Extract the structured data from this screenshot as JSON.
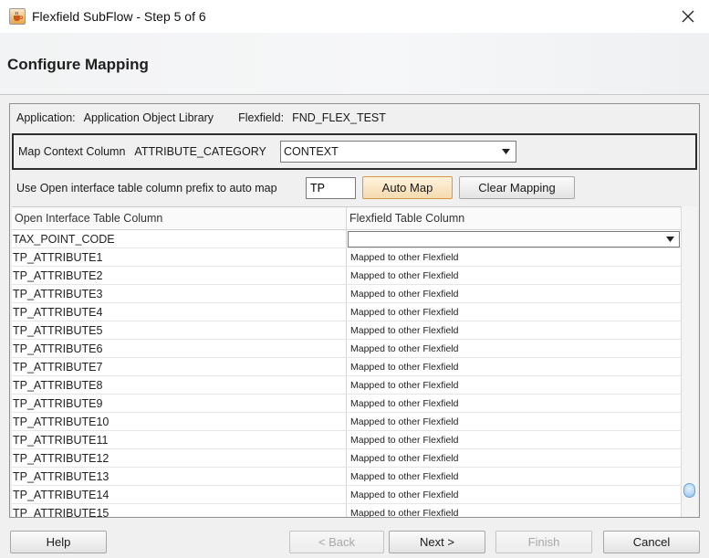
{
  "window": {
    "title": "Flexfield SubFlow - Step 5 of 6",
    "app_icon": "java-cup-icon",
    "close_icon": "close-x-icon"
  },
  "header": {
    "title": "Configure Mapping"
  },
  "info": {
    "application_label": "Application:",
    "application_value": "Application Object Library",
    "flexfield_label": "Flexfield:",
    "flexfield_value": "FND_FLEX_TEST"
  },
  "context": {
    "label": "Map Context Column",
    "column": "ATTRIBUTE_CATEGORY",
    "selected": "CONTEXT"
  },
  "prefix": {
    "label": "Use Open interface table column prefix to auto map",
    "value": "TP",
    "auto_map_label": "Auto Map",
    "clear_mapping_label": "Clear Mapping"
  },
  "grid": {
    "columns": [
      "Open Interface Table Column",
      "Flexfield Table Column"
    ],
    "rows": [
      {
        "column": "TAX_POINT_CODE",
        "mapping": ""
      },
      {
        "column": "TP_ATTRIBUTE1",
        "mapping": "Mapped to other Flexfield"
      },
      {
        "column": "TP_ATTRIBUTE2",
        "mapping": "Mapped to other Flexfield"
      },
      {
        "column": "TP_ATTRIBUTE3",
        "mapping": "Mapped to other Flexfield"
      },
      {
        "column": "TP_ATTRIBUTE4",
        "mapping": "Mapped to other Flexfield"
      },
      {
        "column": "TP_ATTRIBUTE5",
        "mapping": "Mapped to other Flexfield"
      },
      {
        "column": "TP_ATTRIBUTE6",
        "mapping": "Mapped to other Flexfield"
      },
      {
        "column": "TP_ATTRIBUTE7",
        "mapping": "Mapped to other Flexfield"
      },
      {
        "column": "TP_ATTRIBUTE8",
        "mapping": "Mapped to other Flexfield"
      },
      {
        "column": "TP_ATTRIBUTE9",
        "mapping": "Mapped to other Flexfield"
      },
      {
        "column": "TP_ATTRIBUTE10",
        "mapping": "Mapped to other Flexfield"
      },
      {
        "column": "TP_ATTRIBUTE11",
        "mapping": "Mapped to other Flexfield"
      },
      {
        "column": "TP_ATTRIBUTE12",
        "mapping": "Mapped to other Flexfield"
      },
      {
        "column": "TP_ATTRIBUTE13",
        "mapping": "Mapped to other Flexfield"
      },
      {
        "column": "TP_ATTRIBUTE14",
        "mapping": "Mapped to other Flexfield"
      },
      {
        "column": "TP_ATTRIBUTE15",
        "mapping": "Mapped to other Flexfield"
      }
    ]
  },
  "footer": {
    "help_label": "Help",
    "back_label": "< Back",
    "next_label": "Next >",
    "finish_label": "Finish",
    "cancel_label": "Cancel"
  },
  "colors": {
    "focus_border": "#d79a3a",
    "scroll_thumb": "#8fc2ec"
  }
}
